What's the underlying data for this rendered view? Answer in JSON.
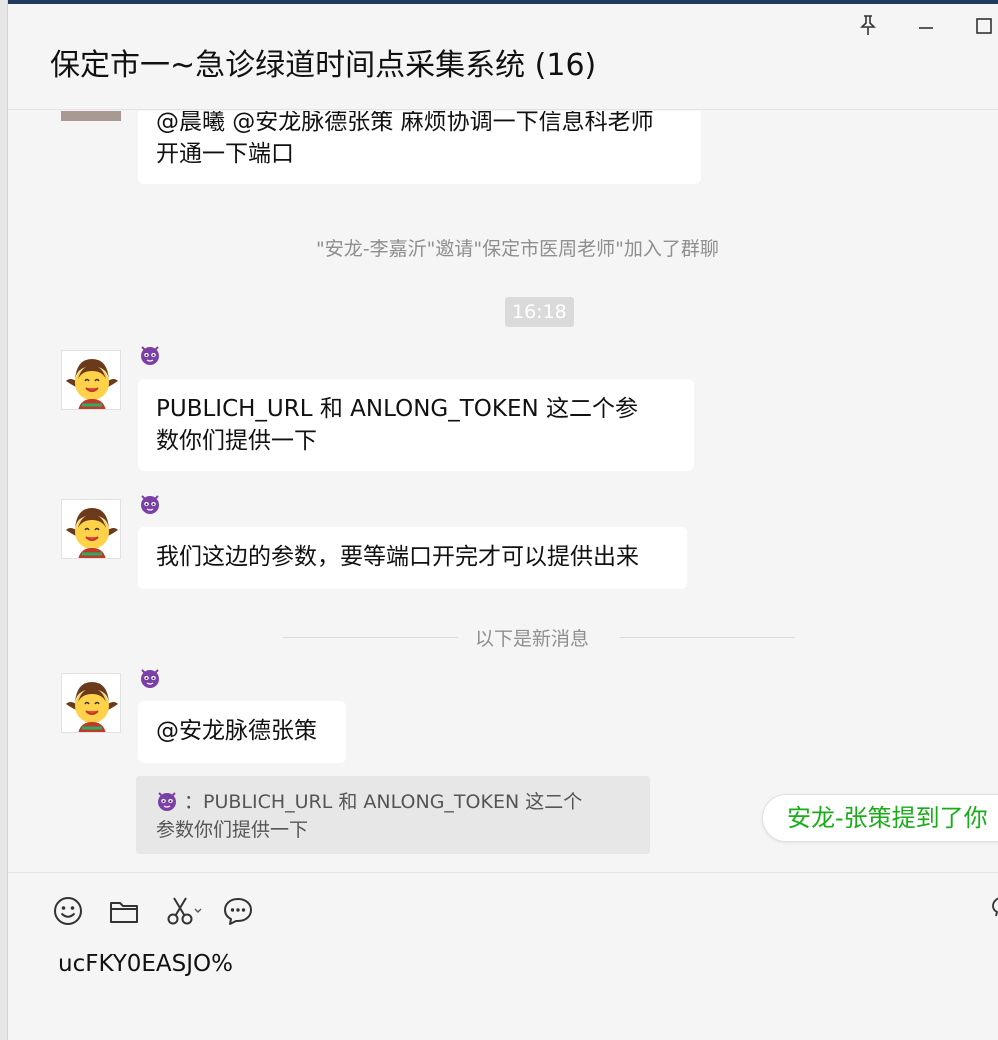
{
  "window": {
    "title": "保定市一~急诊绿道时间点采集系统 (16)",
    "controls": [
      "pin",
      "minimize",
      "maximize"
    ]
  },
  "messages": [
    {
      "type": "text",
      "avatar": "photo",
      "text_line1": "@晨曦 @安龙脉德张策 麻烦协调一下信息科老师",
      "text_line2": "开通一下端口"
    },
    {
      "type": "system",
      "text": "\"安龙-李嘉沂\"邀请\"保定市医周老师\"加入了群聊"
    },
    {
      "type": "time",
      "text": "16:18"
    },
    {
      "type": "text",
      "avatar": "smiley-girl",
      "sender_icon": "devil-emoji",
      "text_line1": "PUBLICH_URL  和 ANLONG_TOKEN  这二个参",
      "text_line2": "数你们提供一下"
    },
    {
      "type": "text",
      "avatar": "smiley-girl",
      "sender_icon": "devil-emoji",
      "text": "我们这边的参数，要等端口开完才可以提供出来"
    },
    {
      "type": "divider",
      "text": "以下是新消息"
    },
    {
      "type": "text",
      "avatar": "smiley-girl",
      "sender_icon": "devil-emoji",
      "text": "@安龙脉德张策",
      "quote": {
        "line1": "：PUBLICH_URL  和 ANLONG_TOKEN  这二个",
        "line2": "参数你们提供一下"
      }
    }
  ],
  "mention_notice": "安龙-张策提到了你",
  "toolbar": {
    "icons": [
      "emoji-icon",
      "folder-icon",
      "scissors-icon",
      "chat-history-icon"
    ]
  },
  "input": {
    "value": "ucFKY0EASJO%"
  },
  "colors": {
    "accent_green": "#1aad19",
    "bubble": "#ffffff",
    "background": "#f5f5f5",
    "devil_purple": "#7b3fa6"
  }
}
